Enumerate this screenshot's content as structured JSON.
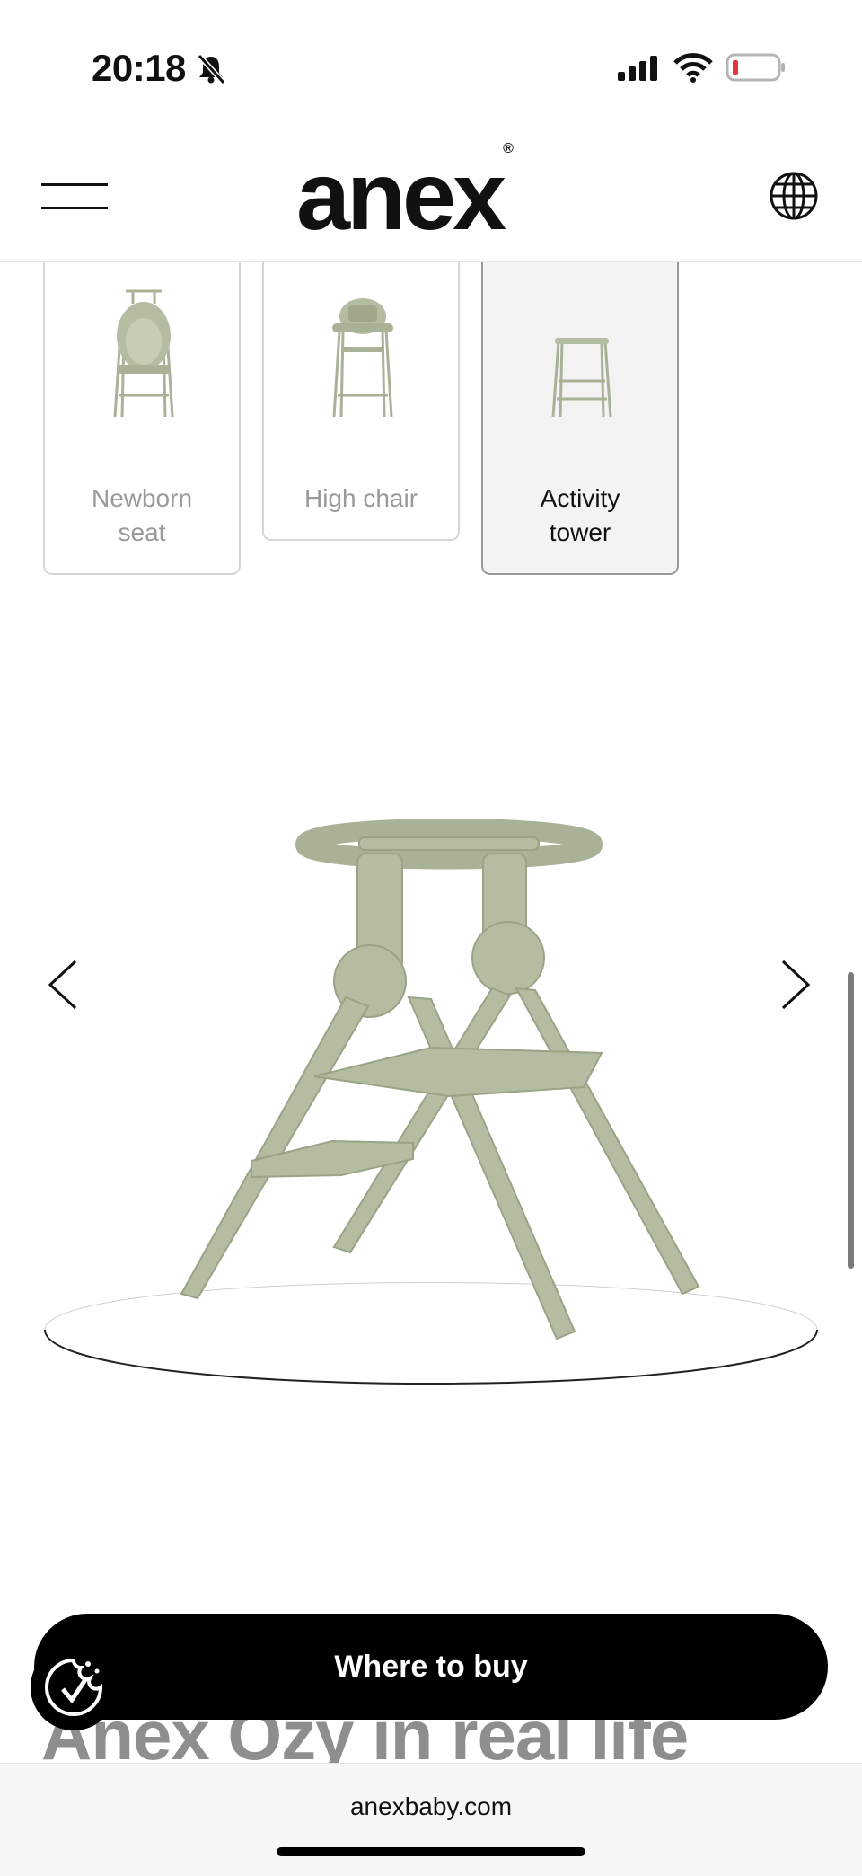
{
  "status_bar": {
    "time": "20:18",
    "icons": [
      "bell-muted-icon",
      "cellular-signal-icon",
      "wifi-icon",
      "battery-low-icon"
    ],
    "battery_color": "#e5373a"
  },
  "header": {
    "logo": "anex",
    "logo_mark": "®",
    "icons": [
      "hamburger-menu-icon",
      "globe-icon"
    ]
  },
  "variants": [
    {
      "label_line1": "Newborn",
      "label_line2": "seat",
      "selected": false
    },
    {
      "label_line1": "High chair",
      "label_line2": "",
      "selected": false
    },
    {
      "label_line1": "Activity",
      "label_line2": "tower",
      "selected": true
    }
  ],
  "carousel": {
    "icons": [
      "chevron-left-icon",
      "chevron-right-icon"
    ],
    "product_color": "#b4bca1"
  },
  "cta": {
    "label": "Where to buy"
  },
  "section": {
    "heading": "Anex Ozy in real life"
  },
  "browser": {
    "url": "anexbaby.com"
  },
  "colors": {
    "accent": "#000000",
    "muted_text": "#999999",
    "selected_card_bg": "#f4f2f3"
  }
}
